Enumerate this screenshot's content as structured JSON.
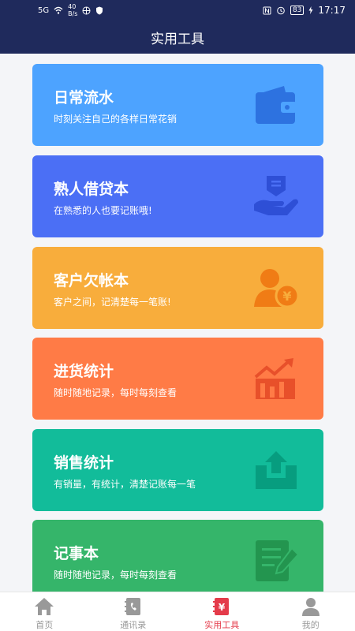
{
  "status_bar": {
    "signal": "5G",
    "speed": "40",
    "speed_unit": "B/s",
    "battery": "83",
    "time": "17:17"
  },
  "header": {
    "title": "实用工具"
  },
  "cards": [
    {
      "title": "日常流水",
      "subtitle": "时刻关注自己的各样日常花销",
      "color": "#4da3ff",
      "icon": "wallet-icon"
    },
    {
      "title": "熟人借贷本",
      "subtitle": "在熟悉的人也要记账哦!",
      "color": "#4b6ff5",
      "icon": "hand-loan-icon"
    },
    {
      "title": "客户欠帐本",
      "subtitle": "客户之间，记清楚每一笔账!",
      "color": "#f8ad3c",
      "icon": "customer-yen-icon"
    },
    {
      "title": "进货统计",
      "subtitle": "随时随地记录，每时每刻查看",
      "color": "#ff7b46",
      "icon": "trend-chart-icon"
    },
    {
      "title": "销售统计",
      "subtitle": "有销量，有统计，清楚记账每一笔",
      "color": "#12bc9a",
      "icon": "upload-box-icon"
    },
    {
      "title": "记事本",
      "subtitle": "随时随地记录，每时每刻查看",
      "color": "#35b56a",
      "icon": "notepad-icon"
    }
  ],
  "tabs": [
    {
      "label": "首页",
      "icon": "home-icon",
      "active": false
    },
    {
      "label": "通讯录",
      "icon": "contacts-icon",
      "active": false
    },
    {
      "label": "实用工具",
      "icon": "tools-book-icon",
      "active": true
    },
    {
      "label": "我的",
      "icon": "user-icon",
      "active": false
    }
  ],
  "colors": {
    "primary_dark": "#1f2a5c",
    "tab_active": "#e43b4a",
    "tab_inactive": "#999999"
  }
}
